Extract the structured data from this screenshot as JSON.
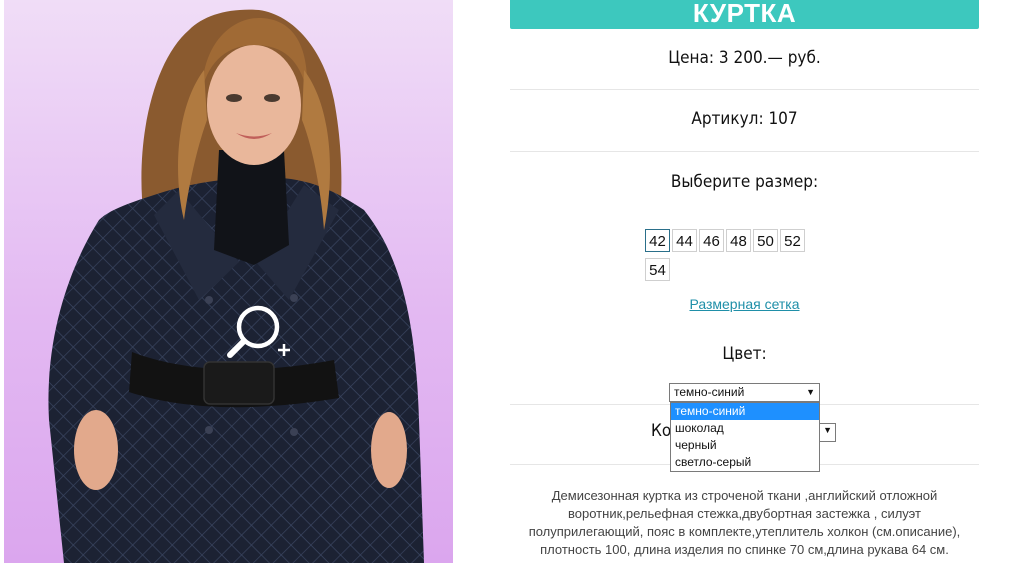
{
  "product": {
    "title": "КУРТКА",
    "price": "Цена: 3 200.— руб.",
    "article": "Артикул: 107",
    "size_label": "Выберите размер:",
    "sizes": [
      "42",
      "44",
      "46",
      "48",
      "50",
      "52",
      "54"
    ],
    "selected_size": "42",
    "size_grid_link": "Размерная сетка",
    "color_label": "Цвет:",
    "color_selected": "темно-синий",
    "color_options": [
      "темно-синий",
      "шоколад",
      "черный",
      "светло-серый"
    ],
    "quantity_label": "Ко",
    "description": "Демисезонная куртка из строченой ткани ,английский отложной воротник,рельефная стежка,двубортная застежка , силуэт полуприлегающий, пояс в комплекте,утеплитель холкон (см.описание), плотность 100, длина изделия по спинке 70 см,длина рукава 64 см."
  },
  "icons": {
    "zoom": "zoom-in-icon",
    "dropdown": "chevron-down-icon"
  },
  "colors": {
    "accent": "#3dc8be",
    "link": "#1f8fa8",
    "highlight": "#1e90ff",
    "image_background": "#e3b9f2"
  }
}
